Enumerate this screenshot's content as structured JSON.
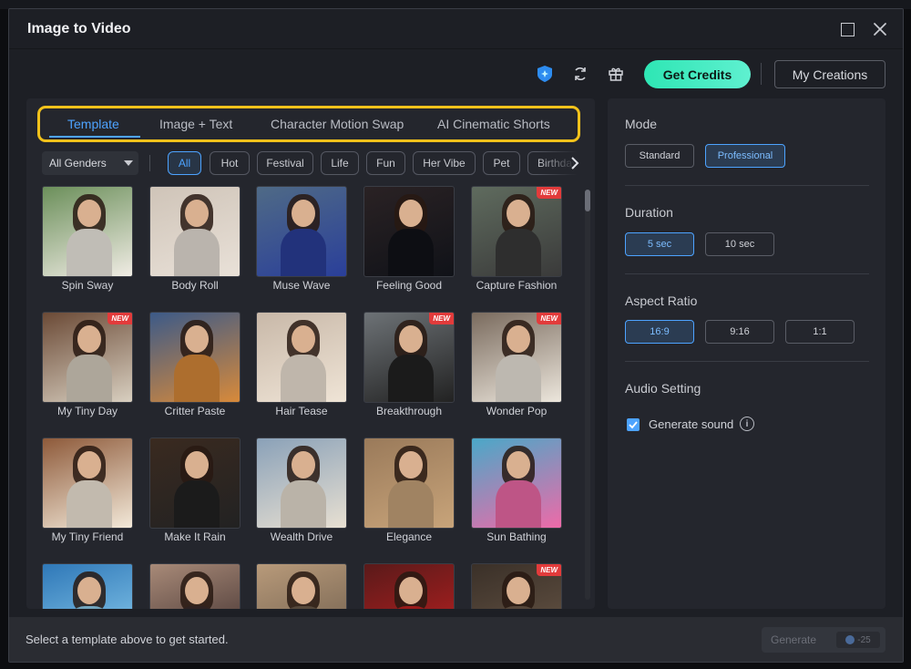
{
  "window": {
    "title": "Image to Video"
  },
  "topbar": {
    "get_credits_label": "Get Credits",
    "my_creations_label": "My Creations"
  },
  "tabs": [
    {
      "label": "Template",
      "active": true
    },
    {
      "label": "Image + Text",
      "active": false
    },
    {
      "label": "Character Motion Swap",
      "active": false
    },
    {
      "label": "AI Cinematic Shorts",
      "active": false
    }
  ],
  "filters": {
    "gender_selected": "All Genders",
    "chips": [
      "All",
      "Hot",
      "Festival",
      "Life",
      "Fun",
      "Her Vibe",
      "Pet",
      "Birthday"
    ]
  },
  "templates": [
    {
      "label": "Spin Sway",
      "new": false
    },
    {
      "label": "Body Roll",
      "new": false
    },
    {
      "label": "Muse Wave",
      "new": false
    },
    {
      "label": "Feeling Good",
      "new": false
    },
    {
      "label": "Capture Fashion",
      "new": true
    },
    {
      "label": "My Tiny Day",
      "new": true
    },
    {
      "label": "Critter Paste",
      "new": false
    },
    {
      "label": "Hair Tease",
      "new": false
    },
    {
      "label": "Breakthrough",
      "new": true
    },
    {
      "label": "Wonder Pop",
      "new": true
    },
    {
      "label": "My Tiny Friend",
      "new": false
    },
    {
      "label": "Make It Rain",
      "new": false
    },
    {
      "label": "Wealth Drive",
      "new": false
    },
    {
      "label": "Elegance",
      "new": false
    },
    {
      "label": "Sun Bathing",
      "new": false
    },
    {
      "label": "",
      "new": false
    },
    {
      "label": "",
      "new": false
    },
    {
      "label": "",
      "new": false
    },
    {
      "label": "",
      "new": false
    },
    {
      "label": "",
      "new": true
    }
  ],
  "new_badge_label": "NEW",
  "settings": {
    "mode_title": "Mode",
    "mode_options": [
      "Standard",
      "Professional"
    ],
    "duration_title": "Duration",
    "duration_options": [
      "5 sec",
      "10 sec"
    ],
    "aspect_title": "Aspect Ratio",
    "aspect_options": [
      "16:9",
      "9:16",
      "1:1"
    ],
    "audio_title": "Audio Setting",
    "generate_sound_label": "Generate sound",
    "generate_sound_checked": true
  },
  "footer": {
    "hint": "Select a template above to get started.",
    "generate_label": "Generate",
    "credit_cost": "-25"
  },
  "colors": {
    "accent": "#4da3ff",
    "get_credits": "#2ee6b4",
    "highlight_box": "#f2c21b",
    "new_badge": "#e23b3b"
  },
  "icons": [
    "ai-sparkle-icon",
    "refresh-icon",
    "gift-icon",
    "maximize-icon",
    "close-icon",
    "chevron-right-icon",
    "check-icon",
    "info-icon",
    "coin-icon"
  ]
}
